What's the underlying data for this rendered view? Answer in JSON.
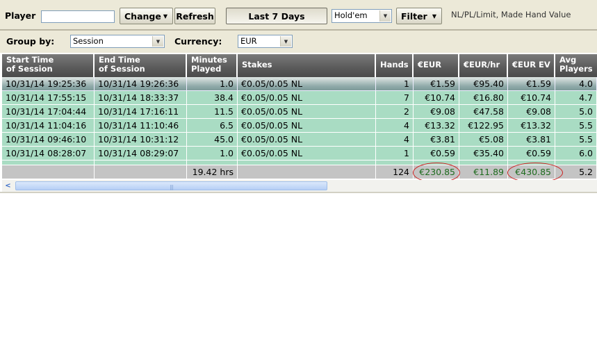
{
  "toolbar": {
    "player_label": "Player",
    "player_value": "",
    "change_label": "Change",
    "refresh_label": "Refresh",
    "date_filter_label": "Last 7 Days",
    "game_select": "Hold'em",
    "filter_label": "Filter",
    "filter_info": "NL/PL/Limit, Made Hand Value"
  },
  "grouping": {
    "group_by_label": "Group by:",
    "group_by_value": "Session",
    "currency_label": "Currency:",
    "currency_value": "EUR"
  },
  "columns": [
    {
      "line1": "Start Time",
      "line2": "of Session"
    },
    {
      "line1": "End Time",
      "line2": "of Session"
    },
    {
      "line1": "Minutes",
      "line2": "Played"
    },
    {
      "line1": "Stakes",
      "line2": ""
    },
    {
      "line1": "Hands",
      "line2": ""
    },
    {
      "line1": "€EUR",
      "line2": ""
    },
    {
      "line1": "€EUR/hr",
      "line2": ""
    },
    {
      "line1": "€EUR EV",
      "line2": ""
    },
    {
      "line1": "Avg",
      "line2": "Players"
    }
  ],
  "rows": [
    {
      "start": "10/31/14 19:25:36",
      "end": "10/31/14 19:26:36",
      "minutes": "1.0",
      "stakes": "€0.05/0.05 NL",
      "hands": "1",
      "eur": "€1.59",
      "eur_hr": "€95.40",
      "eur_ev": "€1.59",
      "avg_players": "4.0"
    },
    {
      "start": "10/31/14 17:55:15",
      "end": "10/31/14 18:33:37",
      "minutes": "38.4",
      "stakes": "€0.05/0.05 NL",
      "hands": "7",
      "eur": "€10.74",
      "eur_hr": "€16.80",
      "eur_ev": "€10.74",
      "avg_players": "4.7"
    },
    {
      "start": "10/31/14 17:04:44",
      "end": "10/31/14 17:16:11",
      "minutes": "11.5",
      "stakes": "€0.05/0.05 NL",
      "hands": "2",
      "eur": "€9.08",
      "eur_hr": "€47.58",
      "eur_ev": "€9.08",
      "avg_players": "5.0"
    },
    {
      "start": "10/31/14 11:04:16",
      "end": "10/31/14 11:10:46",
      "minutes": "6.5",
      "stakes": "€0.05/0.05 NL",
      "hands": "4",
      "eur": "€13.32",
      "eur_hr": "€122.95",
      "eur_ev": "€13.32",
      "avg_players": "5.5"
    },
    {
      "start": "10/31/14 09:46:10",
      "end": "10/31/14 10:31:12",
      "minutes": "45.0",
      "stakes": "€0.05/0.05 NL",
      "hands": "4",
      "eur": "€3.81",
      "eur_hr": "€5.08",
      "eur_ev": "€3.81",
      "avg_players": "5.5"
    },
    {
      "start": "10/31/14 08:28:07",
      "end": "10/31/14 08:29:07",
      "minutes": "1.0",
      "stakes": "€0.05/0.05 NL",
      "hands": "1",
      "eur": "€0.59",
      "eur_hr": "€35.40",
      "eur_ev": "€0.59",
      "avg_players": "6.0"
    }
  ],
  "totals": {
    "minutes": "19.42 hrs",
    "hands": "124",
    "eur": "€230.85",
    "eur_hr": "€11.89",
    "eur_ev": "€430.85",
    "avg_players": "5.2"
  },
  "colors": {
    "row_bg": "#a9dcc3",
    "header_bg": "#5a5a5a",
    "total_bg": "#c4c4c4",
    "total_green": "#1e6b1e",
    "annotation_red": "#cc1f1f"
  }
}
